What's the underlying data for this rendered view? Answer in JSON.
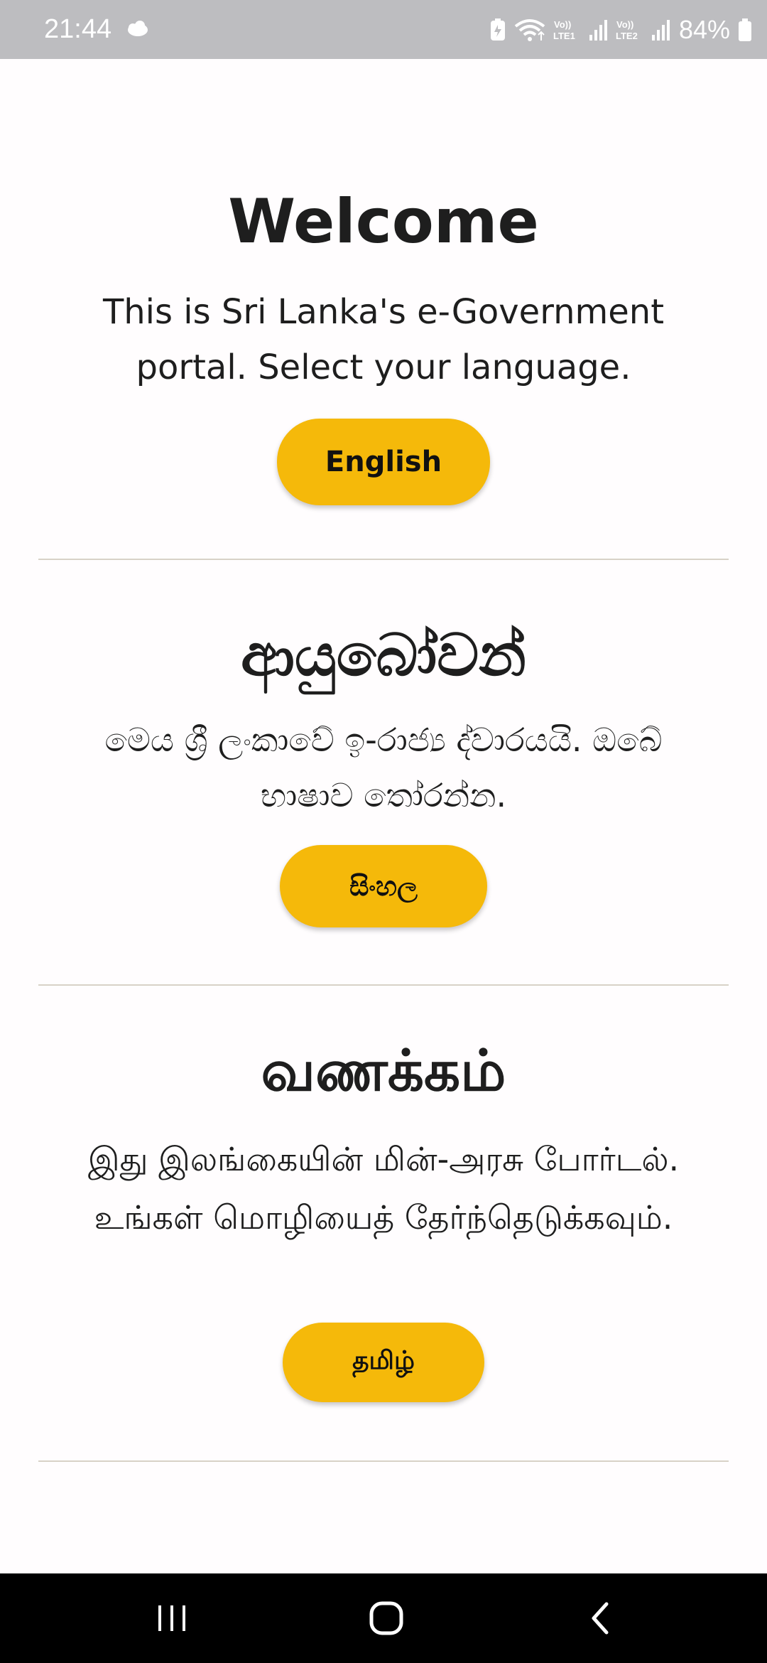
{
  "status_bar": {
    "time": "21:44",
    "battery_percent": "84%",
    "icons": [
      "cloud-icon",
      "battery-saver-icon",
      "wifi-icon",
      "volte-lte1-icon",
      "signal-icon",
      "volte-lte2-icon",
      "signal-icon",
      "battery-icon"
    ],
    "volte1": "Vo)) LTE1",
    "volte2": "Vo)) LTE2"
  },
  "sections": {
    "english": {
      "heading": "Welcome",
      "description": "This is Sri Lanka's e-Government portal. Select your language.",
      "button": "English"
    },
    "sinhala": {
      "heading": "ආයුබෝවන්",
      "description": "මෙය ශ්‍රී ලංකාවේ ඉ-රාජ්‍ය ද්වාරයයි. ඔබේ භාෂාව තෝරන්න.",
      "button": "සිංහල"
    },
    "tamil": {
      "heading": "வணக்கம்",
      "description": "இது இலங்கையின் மின்-அரசு போர்டல். உங்கள் மொழியைத் தேர்ந்தெடுக்கவும்.",
      "button": "தமிழ்"
    }
  },
  "nav_bar": {
    "icons": [
      "recent-apps-icon",
      "home-icon",
      "back-icon"
    ]
  },
  "colors": {
    "accent": "#F5B90A",
    "background": "#FFFDFE",
    "status_bar": "#BDBDC0",
    "divider": "#D8D2C7",
    "nav_bar": "#000000",
    "text": "#1E1E1E"
  }
}
